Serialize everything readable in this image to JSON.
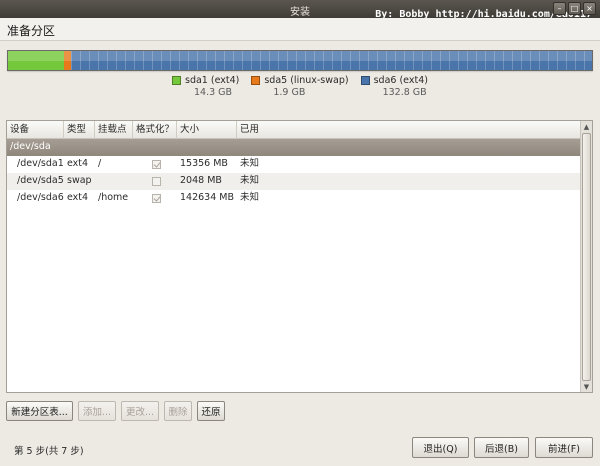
{
  "window": {
    "title": "安装",
    "watermark": "By: Bobby http://hi.baidu.com/ea0117"
  },
  "header": {
    "title": "准备分区"
  },
  "partition_bar": {
    "segments": [
      {
        "name": "sda1 (ext4)",
        "size": "14.3 GB",
        "color": "#75c73b",
        "fraction": 0.0955
      },
      {
        "name": "sda5 (linux-swap)",
        "size": "1.9 GB",
        "color": "#e87a1c",
        "fraction": 0.0127
      },
      {
        "name": "sda6 (ext4)",
        "size": "132.8 GB",
        "color": "#4a75ab",
        "fraction": 0.8918
      }
    ]
  },
  "table": {
    "headers": [
      "设备",
      "类型",
      "挂载点",
      "格式化？",
      "大小",
      "已用"
    ],
    "group": "/dev/sda",
    "rows": [
      {
        "device": "/dev/sda1",
        "type": "ext4",
        "mount": "/",
        "format": true,
        "size": "15356 MB",
        "used": "未知"
      },
      {
        "device": "/dev/sda5",
        "type": "swap",
        "mount": "",
        "format": false,
        "size": "2048 MB",
        "used": "未知"
      },
      {
        "device": "/dev/sda6",
        "type": "ext4",
        "mount": "/home",
        "format": true,
        "size": "142634 MB",
        "used": "未知"
      }
    ]
  },
  "actions": {
    "new_table": "新建分区表...",
    "add": "添加...",
    "change": "更改...",
    "delete": "删除",
    "revert": "还原"
  },
  "footer": {
    "step": "第 5 步(共 7 步)",
    "quit": "退出(Q)",
    "back": "后退(B)",
    "forward": "前进(F)"
  },
  "icons": {
    "minimize": "minimize-icon",
    "maximize": "maximize-icon",
    "close": "close-icon"
  }
}
